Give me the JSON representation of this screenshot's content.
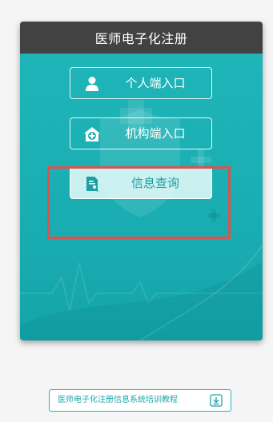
{
  "header": {
    "title": "医师电子化注册"
  },
  "entries": {
    "personal": {
      "label": "个人端入口",
      "icon": "user-icon"
    },
    "institution": {
      "label": "机构端入口",
      "icon": "hospital-icon"
    },
    "query": {
      "label": "信息查询",
      "icon": "document-search-icon"
    }
  },
  "footer": {
    "tutorial_link": "医师电子化注册信息系统培训教程",
    "icon": "download-icon"
  },
  "colors": {
    "header_bg": "#424242",
    "body_teal": "#19adb1",
    "highlight": "#d9534f",
    "query_text": "#1c9ea3"
  }
}
